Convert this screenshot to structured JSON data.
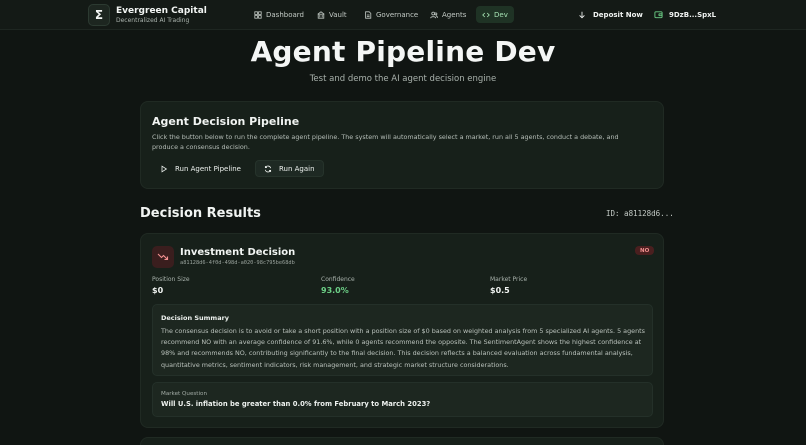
{
  "brand": {
    "logo_glyph": "Σ",
    "name": "Evergreen Capital",
    "subtitle": "Decentralized AI Trading"
  },
  "nav": {
    "items": [
      {
        "label": "Dashboard",
        "icon": "grid-icon"
      },
      {
        "label": "Vault",
        "icon": "vault-icon"
      },
      {
        "label": "Governance",
        "icon": "document-icon"
      },
      {
        "label": "Agents",
        "icon": "users-icon"
      },
      {
        "label": "Dev",
        "icon": "code-icon",
        "active": true
      }
    ],
    "deposit_label": "Deposit Now",
    "wallet_label": "9DzB...SpxL"
  },
  "hero": {
    "title": "Agent Pipeline Dev",
    "subtitle": "Test and demo the AI agent decision engine"
  },
  "pipeline": {
    "title": "Agent Decision Pipeline",
    "description": "Click the button below to run the complete agent pipeline. The system will automatically select a market, run all 5 agents, conduct a debate, and produce a consensus decision.",
    "run_label": "Run Agent Pipeline",
    "again_label": "Run Again"
  },
  "results": {
    "title": "Decision Results",
    "id_label": "ID: a81128d6..."
  },
  "decision": {
    "title": "Investment Decision",
    "hash": "a81128d6-4f0d-498d-a020-98c795be68db",
    "badge": "NO",
    "metrics": {
      "position_label": "Position Size",
      "position_value": "$0",
      "confidence_label": "Confidence",
      "confidence_value": "93.0%",
      "price_label": "Market Price",
      "price_value": "$0.5"
    },
    "summary_title": "Decision Summary",
    "summary_text": "The consensus decision is to avoid or take a short position with a position size of $0 based on weighted analysis from 5 specialized AI agents. 5 agents recommend NO with an average confidence of 91.6%, while 0 agents recommend the opposite. The SentimentAgent shows the highest confidence at 98% and recommends NO, contributing significantly to the final decision. This decision reflects a balanced evaluation across fundamental analysis, quantitative metrics, sentiment indicators, risk management, and strategic market structure considerations.",
    "question_label": "Market Question",
    "question_text": "Will U.S. inflation be greater than 0.0% from February to March 2023?"
  },
  "colors": {
    "background": "#101512",
    "card": "#17201a",
    "accent_green": "#6ccf86",
    "badge_red": "#f08f8f"
  }
}
